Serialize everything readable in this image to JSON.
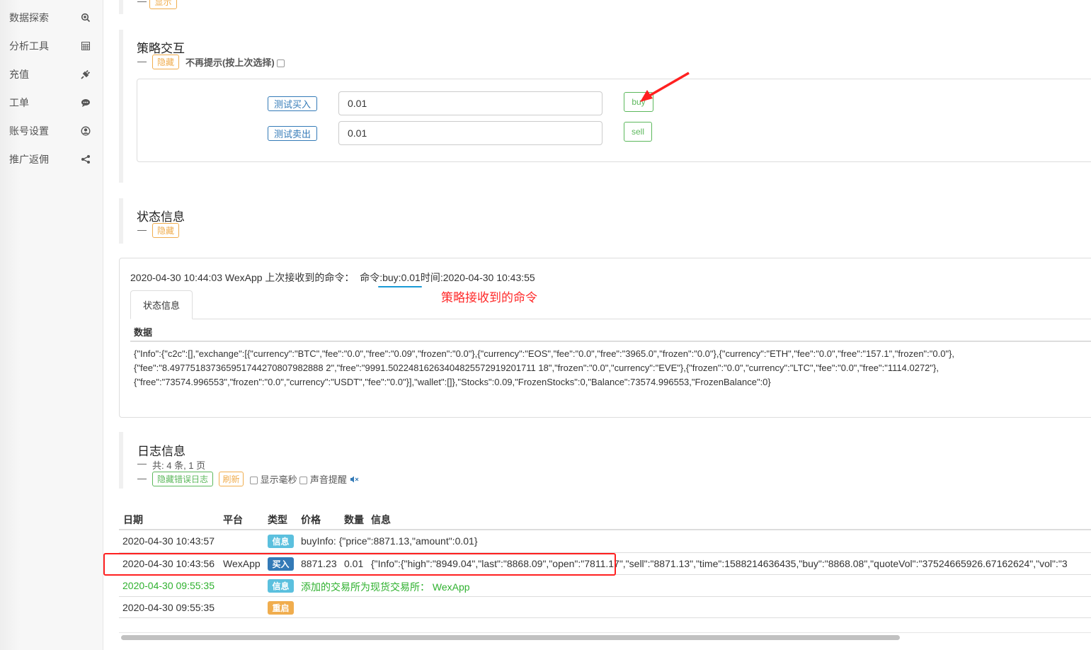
{
  "sidebar": {
    "items": [
      {
        "label": "数据探索",
        "icon": "search-plus-icon"
      },
      {
        "label": "分析工具",
        "icon": "calculator-icon"
      },
      {
        "label": "充值",
        "icon": "plug-icon"
      },
      {
        "label": "工单",
        "icon": "comment-icon"
      },
      {
        "label": "账号设置",
        "icon": "user-circle-icon"
      },
      {
        "label": "推广返佣",
        "icon": "share-icon"
      }
    ]
  },
  "top": {
    "show_label": "显示",
    "dash": "—"
  },
  "interaction": {
    "title": "策略交互",
    "hide_label": "隐藏",
    "no_prompt_label": "不再提示(按上次选择)",
    "rows": [
      {
        "label": "测试买入",
        "value": "0.01",
        "button": "buy"
      },
      {
        "label": "测试卖出",
        "value": "0.01",
        "button": "sell"
      }
    ]
  },
  "status": {
    "title": "状态信息",
    "hide_label": "隐藏",
    "line_prefix": "2020-04-30 10:44:03 WexApp 上次接收到的命令：  ",
    "line_cmd": "命令:buy:0.01",
    "line_suffix": "时间:2020-04-30 10:43:55",
    "annotation": "策略接收到的命令",
    "tab": "状态信息",
    "data_header": "数据",
    "json_lines": [
      "{\"Info\":{\"c2c\":[],\"exchange\":[{\"currency\":\"BTC\",\"fee\":\"0.0\",\"free\":\"0.09\",\"frozen\":\"0.0\"},{\"currency\":\"EOS\",\"fee\":\"0.0\",\"free\":\"3965.0\",\"frozen\":\"0.0\"},{\"currency\":\"ETH\",\"fee\":\"0.0\",\"free\":\"157.1\",\"frozen\":\"0.0\"},",
      "{\"fee\":\"8.497751837365951744270807982888 2\",\"free\":\"9991.50224816263404825572919201711 18\",\"frozen\":\"0.0\",\"currency\":\"EVE\"},{\"frozen\":\"0.0\",\"currency\":\"LTC\",\"fee\":\"0.0\",\"free\":\"1114.0272\"},",
      "{\"free\":\"73574.996553\",\"frozen\":\"0.0\",\"currency\":\"USDT\",\"fee\":\"0.0\"}],\"wallet\":[]},\"Stocks\":0.09,\"FrozenStocks\":0,\"Balance\":73574.996553,\"FrozenBalance\":0}"
    ]
  },
  "log": {
    "title": "日志信息",
    "summary": "共: 4 条, 1 页",
    "hide_errors": "隐藏错误日志",
    "refresh": "刷新",
    "show_ms": "显示毫秒",
    "sound": "声音提醒",
    "columns": [
      "日期",
      "平台",
      "类型",
      "价格",
      "数量",
      "信息"
    ],
    "rows": [
      {
        "date": "2020-04-30 10:43:57",
        "platform": "",
        "type": "信息",
        "type_color": "#5bc0de",
        "price": "",
        "amount": "",
        "info": "buyInfo: {\"price\":8871.13,\"amount\":0.01}",
        "color": "#333"
      },
      {
        "date": "2020-04-30 10:43:56",
        "platform": "WexApp",
        "type": "买入",
        "type_color": "#337ab7",
        "price": "8871.23",
        "amount": "0.01",
        "info": "{\"Info\":{\"high\":\"8949.04\",\"last\":\"8868.09\",\"open\":\"7811.17\",\"sell\":\"8871.13\",\"time\":1588214636435,\"buy\":\"8868.08\",\"quoteVol\":\"37524665926.67162624\",\"vol\":\"3",
        "color": "#333"
      },
      {
        "date": "2020-04-30 09:55:35",
        "platform": "",
        "type": "信息",
        "type_color": "#5bc0de",
        "price": "",
        "amount": "",
        "info": "添加的交易所为现货交易所：  WexApp",
        "color": "#2fb12f"
      },
      {
        "date": "2020-04-30 09:55:35",
        "platform": "",
        "type": "重启",
        "type_color": "#f0ad4e",
        "price": "",
        "amount": "",
        "info": "",
        "color": "#333"
      }
    ]
  },
  "colors": {
    "annotation_red": "#ff2a2a",
    "underline_blue": "#1a9ad6"
  }
}
